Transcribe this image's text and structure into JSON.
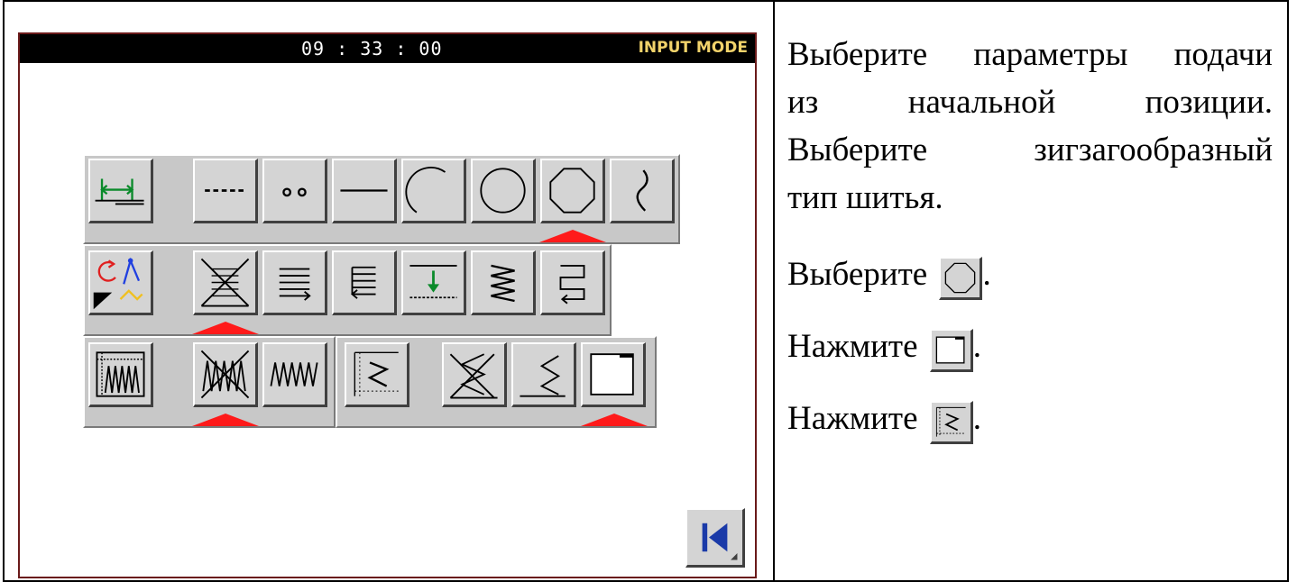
{
  "screen": {
    "clock": "09 : 33 : 00",
    "mode": "INPUT MODE",
    "colors": {
      "topbar": "#000000",
      "mode_text": "#f2d36b",
      "selection_marker": "#ff1a1a",
      "button_face": "#d4d4d4"
    },
    "row1": {
      "feed_button": "feed-icon",
      "stitch_types": [
        "dashed-line-icon",
        "point-icon",
        "straight-line-icon",
        "arc-icon",
        "circle-icon",
        "octagon-icon",
        "curve-icon"
      ],
      "selected": "octagon-icon"
    },
    "row2": {
      "mode_button": "sequence-icon",
      "options": [
        "no-reverse-icon",
        "reverse-forward-icon",
        "reverse-back-icon",
        "feed-down-icon",
        "zigzag-reverse-icon",
        "reverse-return-icon"
      ],
      "selected": "no-reverse-icon"
    },
    "row3": {
      "zigzag_button": "zigzag-settings-icon",
      "options": [
        "no-zigzag-icon",
        "zigzag-icon",
        "zigzag-param-icon",
        "no-zigzag-cross-icon",
        "zigzag-line-icon",
        "frame-corner-icon"
      ],
      "selected": [
        "no-zigzag-icon",
        "frame-corner-icon"
      ]
    },
    "back_button": "back-to-start-icon"
  },
  "instructions": {
    "para1_lines": [
      "Выберите параметры подачи",
      "из начальной позиции.",
      "Выберите зигзагообразный"
    ],
    "para1_last": "тип шитья.",
    "step1": {
      "label": "Выберите",
      "icon": "octagon-icon",
      "end": "."
    },
    "step2": {
      "label": "Нажмите",
      "icon": "frame-corner-icon",
      "end": "."
    },
    "step3": {
      "label": "Нажмите",
      "icon": "zigzag-param-icon",
      "end": "."
    }
  }
}
